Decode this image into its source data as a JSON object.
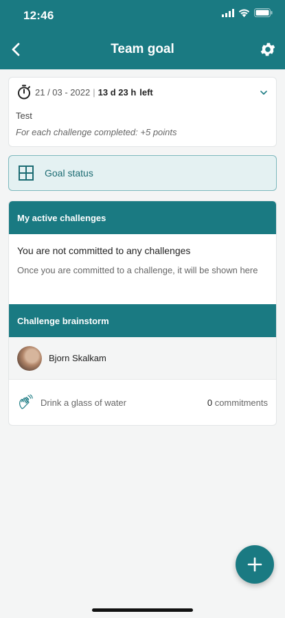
{
  "status_bar": {
    "time": "12:46"
  },
  "nav": {
    "title": "Team goal",
    "back_icon": "chevron-left-icon",
    "settings_icon": "gear-icon"
  },
  "goal": {
    "date": "21 / 03 - 2022",
    "remaining": "13 d 23 h",
    "remaining_suffix": "left",
    "name": "Test",
    "rule": "For each challenge completed: +5 points"
  },
  "goal_status": {
    "label": "Goal status",
    "icon": "grid-icon"
  },
  "active": {
    "header": "My active challenges",
    "empty_title": "You are not committed to any challenges",
    "empty_desc": "Once you are committed to a challenge, it will be shown here"
  },
  "brainstorm": {
    "header": "Challenge brainstorm",
    "author": "Bjorn Skalkam",
    "challenge": "Drink a glass of water",
    "commit_count": "0",
    "commit_label": "commitments"
  },
  "colors": {
    "brand": "#1a7a82",
    "status_bg": "#e4f1f2"
  }
}
